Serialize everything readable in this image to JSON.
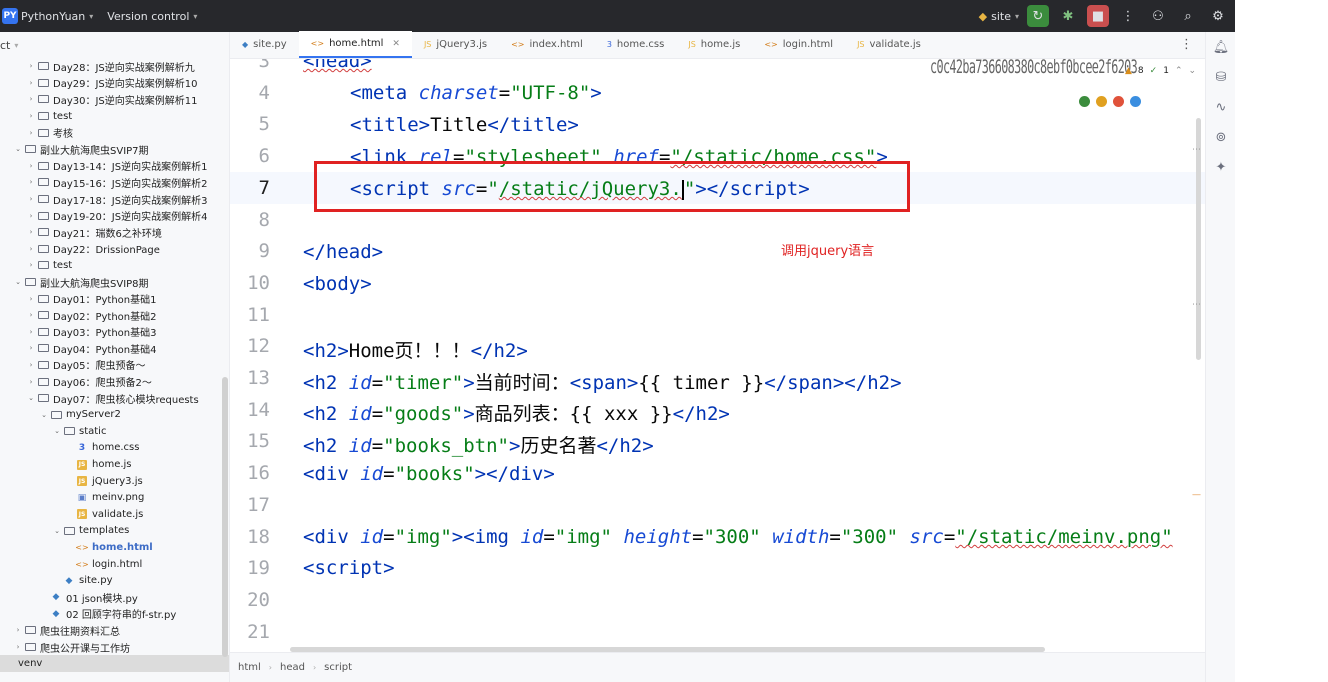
{
  "titlebar": {
    "project_badge": "PY",
    "project_name": "PythonYuan",
    "vcs_label": "Version control",
    "run_config": "site"
  },
  "sidebar": {
    "header_label": "ct",
    "rows": [
      {
        "indent": 2,
        "arrow": "›",
        "kind": "folder",
        "label": "Day28：JS逆向实战案例解析九"
      },
      {
        "indent": 2,
        "arrow": "›",
        "kind": "folder",
        "label": "Day29：JS逆向实战案例解析10"
      },
      {
        "indent": 2,
        "arrow": "›",
        "kind": "folder",
        "label": "Day30：JS逆向实战案例解析11"
      },
      {
        "indent": 2,
        "arrow": "›",
        "kind": "folder",
        "label": "test"
      },
      {
        "indent": 2,
        "arrow": "›",
        "kind": "folder",
        "label": "考核"
      },
      {
        "indent": 1,
        "arrow": "⌄",
        "kind": "folder",
        "label": "副业大航海爬虫SVIP7期"
      },
      {
        "indent": 2,
        "arrow": "›",
        "kind": "folder",
        "label": "Day13-14：JS逆向实战案例解析1"
      },
      {
        "indent": 2,
        "arrow": "›",
        "kind": "folder",
        "label": "Day15-16：JS逆向实战案例解析2"
      },
      {
        "indent": 2,
        "arrow": "›",
        "kind": "folder",
        "label": "Day17-18：JS逆向实战案例解析3"
      },
      {
        "indent": 2,
        "arrow": "›",
        "kind": "folder",
        "label": "Day19-20：JS逆向实战案例解析4"
      },
      {
        "indent": 2,
        "arrow": "›",
        "kind": "folder",
        "label": "Day21：瑞数6之补环境"
      },
      {
        "indent": 2,
        "arrow": "›",
        "kind": "folder",
        "label": "Day22：DrissionPage"
      },
      {
        "indent": 2,
        "arrow": "›",
        "kind": "folder",
        "label": "test"
      },
      {
        "indent": 1,
        "arrow": "⌄",
        "kind": "folder",
        "label": "副业大航海爬虫SVIP8期"
      },
      {
        "indent": 2,
        "arrow": "›",
        "kind": "folder",
        "label": "Day01：Python基础1"
      },
      {
        "indent": 2,
        "arrow": "›",
        "kind": "folder",
        "label": "Day02：Python基础2"
      },
      {
        "indent": 2,
        "arrow": "›",
        "kind": "folder",
        "label": "Day03：Python基础3"
      },
      {
        "indent": 2,
        "arrow": "›",
        "kind": "folder",
        "label": "Day04：Python基础4"
      },
      {
        "indent": 2,
        "arrow": "›",
        "kind": "folder",
        "label": "Day05：爬虫预备～"
      },
      {
        "indent": 2,
        "arrow": "›",
        "kind": "folder",
        "label": "Day06：爬虫预备2～"
      },
      {
        "indent": 2,
        "arrow": "⌄",
        "kind": "folder",
        "label": "Day07：爬虫核心模块requests"
      },
      {
        "indent": 3,
        "arrow": "⌄",
        "kind": "folder",
        "label": "myServer2"
      },
      {
        "indent": 4,
        "arrow": "⌄",
        "kind": "folder",
        "label": "static"
      },
      {
        "indent": 5,
        "arrow": "",
        "kind": "css",
        "label": "home.css"
      },
      {
        "indent": 5,
        "arrow": "",
        "kind": "js",
        "label": "home.js"
      },
      {
        "indent": 5,
        "arrow": "",
        "kind": "js",
        "label": "jQuery3.js"
      },
      {
        "indent": 5,
        "arrow": "",
        "kind": "png",
        "label": "meinv.png"
      },
      {
        "indent": 5,
        "arrow": "",
        "kind": "js",
        "label": "validate.js"
      },
      {
        "indent": 4,
        "arrow": "⌄",
        "kind": "folder",
        "label": "templates"
      },
      {
        "indent": 5,
        "arrow": "",
        "kind": "html",
        "label": "home.html",
        "selected": true
      },
      {
        "indent": 5,
        "arrow": "",
        "kind": "html",
        "label": "login.html"
      },
      {
        "indent": 4,
        "arrow": "",
        "kind": "py",
        "label": "site.py"
      },
      {
        "indent": 3,
        "arrow": "",
        "kind": "py",
        "label": "01 json模块.py"
      },
      {
        "indent": 3,
        "arrow": "",
        "kind": "py",
        "label": "02 回顾字符串的f-str.py"
      },
      {
        "indent": 1,
        "arrow": "›",
        "kind": "folder",
        "label": "爬虫往期资料汇总"
      },
      {
        "indent": 1,
        "arrow": "›",
        "kind": "folder",
        "label": "爬虫公开课与工作坊"
      },
      {
        "indent": 0,
        "arrow": "",
        "kind": "none",
        "label": "venv",
        "venv": true
      }
    ]
  },
  "tabs": [
    {
      "label": "site.py",
      "icon": "py",
      "active": false
    },
    {
      "label": "home.html",
      "icon": "html",
      "active": true
    },
    {
      "label": "jQuery3.js",
      "icon": "js",
      "active": false
    },
    {
      "label": "index.html",
      "icon": "html",
      "active": false
    },
    {
      "label": "home.css",
      "icon": "css",
      "active": false
    },
    {
      "label": "home.js",
      "icon": "js",
      "active": false
    },
    {
      "label": "login.html",
      "icon": "html",
      "active": false
    },
    {
      "label": "validate.js",
      "icon": "js",
      "active": false
    }
  ],
  "editor": {
    "line_numbers": [
      "3",
      "4",
      "5",
      "6",
      "7",
      "8",
      "9",
      "10",
      "11",
      "12",
      "13",
      "14",
      "15",
      "16",
      "17",
      "18",
      "19",
      "20",
      "21"
    ],
    "current_line": "7",
    "hash_overlay": "c0c42ba736608380c8ebf0bcee2f6203",
    "inspection": {
      "warnings": "8",
      "ok": "1"
    },
    "annotation": "调用jquery语言"
  },
  "code": {
    "l4": {
      "tag1": "meta",
      "attr": "charset",
      "val": "\"UTF-8\""
    },
    "l5": {
      "tag": "title",
      "text": "Title"
    },
    "l6": {
      "tag": "link",
      "attr1": "rel",
      "val1": "\"stylesheet\"",
      "attr2": "href",
      "val2": "\"/static/home.css\""
    },
    "l7": {
      "tag": "script",
      "attr": "src",
      "val": "/static/jQuery3."
    },
    "l9": {
      "tag": "head"
    },
    "l10": {
      "tag": "body"
    },
    "l12": {
      "tag": "h2",
      "text": "Home页！！！"
    },
    "l13": {
      "attr": "id",
      "val": "\"timer\"",
      "text": "当前时间：",
      "span": "span",
      "inner": "{{ timer }}"
    },
    "l14": {
      "val": "\"goods\"",
      "text": "商品列表：{{ xxx }}"
    },
    "l15": {
      "val": "\"books_btn\"",
      "text": "历史名著"
    },
    "l16": {
      "tag": "div",
      "val": "\"books\""
    },
    "l18": {
      "val1": "\"img\"",
      "tag2": "img",
      "val2": "\"img\"",
      "attr3": "height",
      "val3": "\"300\"",
      "attr4": "width",
      "val4": "\"300\"",
      "attr5": "src",
      "val5": "\"/static/meinv.png\""
    },
    "l19": {
      "tag": "script"
    }
  },
  "breadcrumb": [
    "html",
    "head",
    "script"
  ],
  "colors": {
    "highlight": "#e02222",
    "tag": "#0033b3",
    "string": "#067d17",
    "attr": "#174ad4"
  }
}
